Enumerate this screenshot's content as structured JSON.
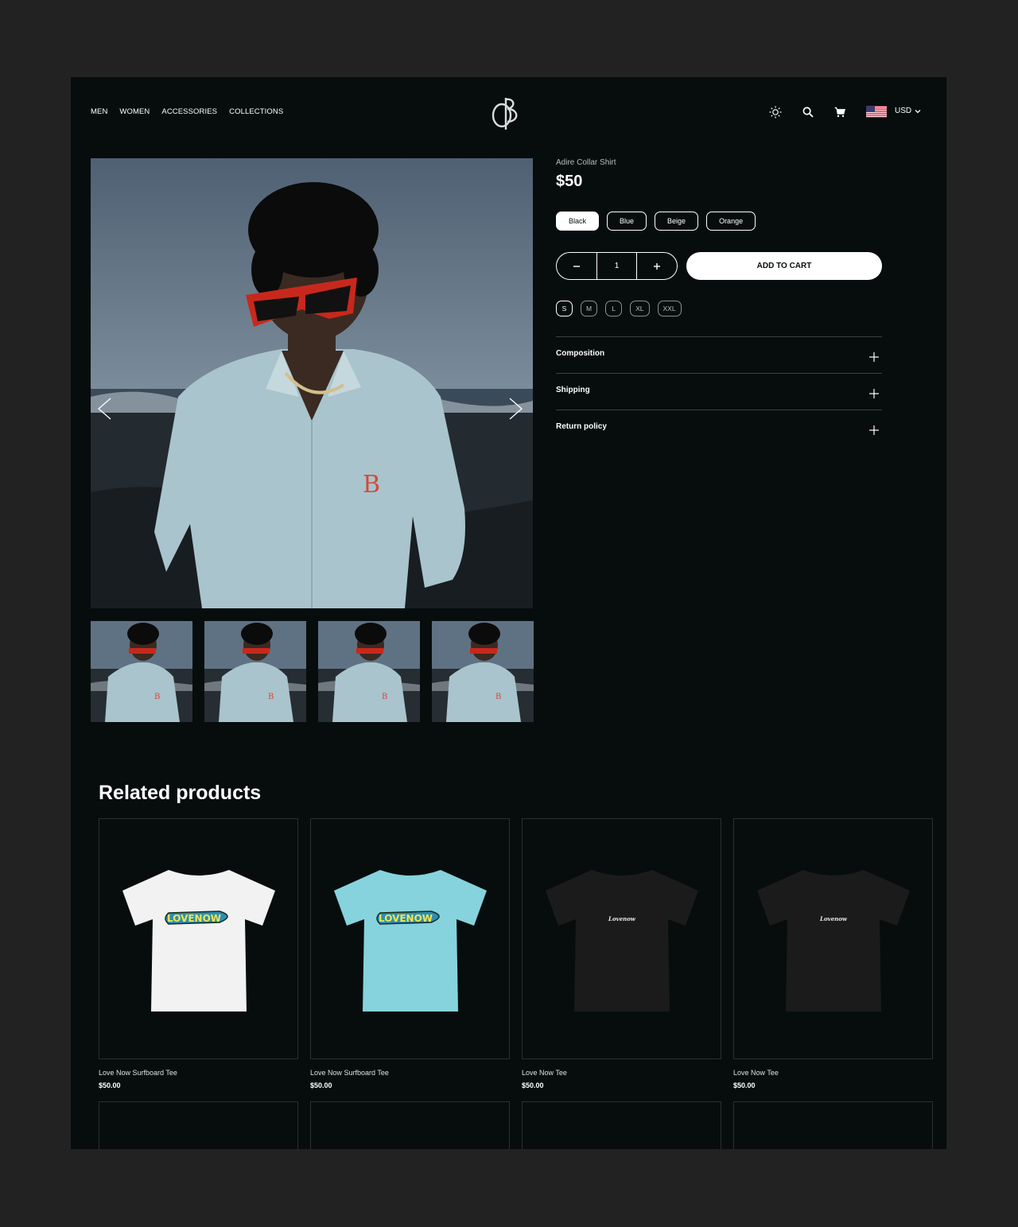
{
  "nav": {
    "items": [
      {
        "label": "MEN"
      },
      {
        "label": "WOMEN"
      },
      {
        "label": "ACCESSORIES"
      },
      {
        "label": "COLLECTIONS"
      }
    ]
  },
  "header": {
    "icons": [
      "sun-icon",
      "search-icon",
      "cart-icon"
    ],
    "currency": "USD"
  },
  "product": {
    "name": "Adire Collar Shirt",
    "price": "$50",
    "colors": [
      {
        "label": "Black",
        "selected": true
      },
      {
        "label": "Blue",
        "selected": false
      },
      {
        "label": "Beige",
        "selected": false
      },
      {
        "label": "Orange",
        "selected": false
      }
    ],
    "quantity": "1",
    "add_to_cart": "ADD TO CART",
    "sizes": [
      {
        "label": "S",
        "selected": true
      },
      {
        "label": "M",
        "selected": false
      },
      {
        "label": "L",
        "selected": false
      },
      {
        "label": "XL",
        "selected": false
      },
      {
        "label": "XXL",
        "selected": false
      }
    ],
    "accordion": [
      {
        "label": "Composition"
      },
      {
        "label": "Shipping"
      },
      {
        "label": "Return policy"
      }
    ]
  },
  "related": {
    "title": "Related products",
    "items": [
      {
        "name": "Love Now Surfboard Tee",
        "price": "$50.00",
        "shirt_color": "#f2f2f2",
        "print": "LOVENOW"
      },
      {
        "name": "Love Now Surfboard Tee",
        "price": "$50.00",
        "shirt_color": "#86d3dd",
        "print": "LOVENOW"
      },
      {
        "name": "Love Now Tee",
        "price": "$50.00",
        "shirt_color": "#1b1b1b",
        "print": "Lovenow"
      },
      {
        "name": "Love Now Tee",
        "price": "$50.00",
        "shirt_color": "#1b1b1b",
        "print": "Lovenow"
      }
    ]
  }
}
